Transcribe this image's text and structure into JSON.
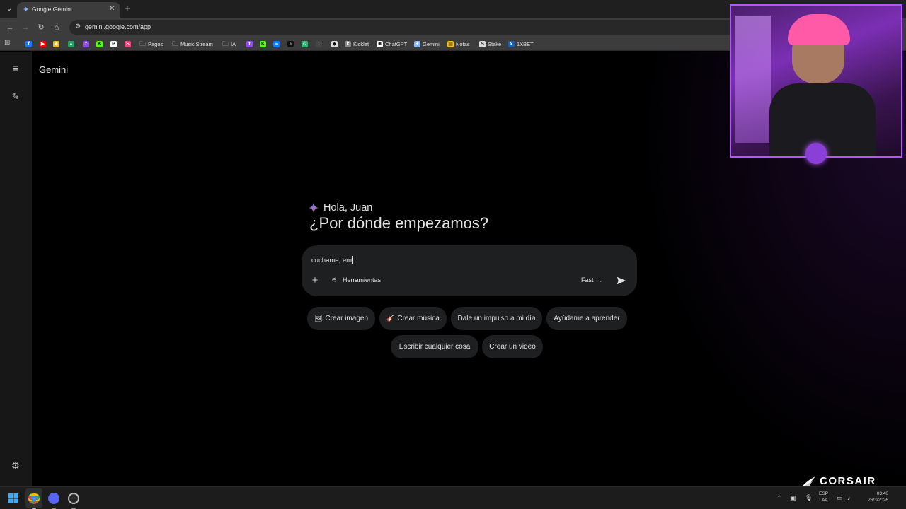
{
  "browser": {
    "tab_title": "Google Gemini",
    "tab_close": "✕",
    "new_tab": "+",
    "url": "gemini.google.com/app",
    "bookmarks": [
      {
        "label": "",
        "icon": "facebook-icon",
        "color": "#1877f2",
        "glyph": "f"
      },
      {
        "label": "",
        "icon": "youtube-icon",
        "color": "#ff0000",
        "glyph": "▶"
      },
      {
        "label": "",
        "icon": "binance-icon",
        "color": "#f0b90b",
        "glyph": "◆"
      },
      {
        "label": "",
        "icon": "google-drive-icon",
        "color": "#1fa463",
        "glyph": "▲"
      },
      {
        "label": "",
        "icon": "twitch-icon",
        "color": "#9146ff",
        "glyph": "t"
      },
      {
        "label": "",
        "icon": "kick-icon",
        "color": "#53fc18",
        "glyph": "K"
      },
      {
        "label": "",
        "icon": "patreon-icon",
        "color": "#ffffff",
        "glyph": "P"
      },
      {
        "label": "",
        "icon": "streamlabs-icon",
        "color": "#e8467c",
        "glyph": "S"
      },
      {
        "label": "Pagos",
        "icon": "folder-icon",
        "color": "",
        "glyph": ""
      },
      {
        "label": "Music Stream",
        "icon": "folder-icon",
        "color": "",
        "glyph": ""
      },
      {
        "label": "IA",
        "icon": "folder-icon",
        "color": "",
        "glyph": ""
      },
      {
        "label": "",
        "icon": "twitch-icon",
        "color": "#9146ff",
        "glyph": "t"
      },
      {
        "label": "",
        "icon": "kick-icon",
        "color": "#53fc18",
        "glyph": "K"
      },
      {
        "label": "",
        "icon": "meta-icon",
        "color": "#0081fb",
        "glyph": "∞"
      },
      {
        "label": "",
        "icon": "tiktok-icon",
        "color": "#111111",
        "glyph": "♪"
      },
      {
        "label": "",
        "icon": "refresh-app-icon",
        "color": "#2ab673",
        "glyph": "↻"
      },
      {
        "label": "",
        "icon": "misc-icon",
        "color": "#444444",
        "glyph": "!"
      },
      {
        "label": "",
        "icon": "diamond-icon",
        "color": "#dddddd",
        "glyph": "◆"
      },
      {
        "label": "Kicklet",
        "icon": "kicklet-icon",
        "color": "#888888",
        "glyph": "k"
      },
      {
        "label": "ChatGPT",
        "icon": "chatgpt-icon",
        "color": "#ffffff",
        "glyph": "✺"
      },
      {
        "label": "Gemini",
        "icon": "gemini-icon",
        "color": "#8ab4f8",
        "glyph": "✦"
      },
      {
        "label": "Notas",
        "icon": "notes-icon",
        "color": "#fbbc04",
        "glyph": "▤"
      },
      {
        "label": "Stake",
        "icon": "stake-icon",
        "color": "#dddddd",
        "glyph": "S"
      },
      {
        "label": "1XBET",
        "icon": "onexbet-icon",
        "color": "#1a5fb4",
        "glyph": "x"
      }
    ]
  },
  "app": {
    "brand": "Gemini",
    "greeting": "Hola, Juan",
    "headline": "¿Por dónde empezamos?",
    "prompt_text": "cuchame, em",
    "tools_label": "Herramientas",
    "mode_label": "Fast",
    "chips_row1": [
      {
        "label": "Crear imagen",
        "icon": "🖼"
      },
      {
        "label": "Crear música",
        "icon": "🎸"
      },
      {
        "label": "Dale un impulso a mi día",
        "icon": ""
      },
      {
        "label": "Ayúdame a aprender",
        "icon": ""
      }
    ],
    "chips_row2": [
      {
        "label": "Escribir cualquier cosa",
        "icon": ""
      },
      {
        "label": "Crear un video",
        "icon": ""
      }
    ]
  },
  "overlay": {
    "brand": "CORSAIR"
  },
  "taskbar": {
    "lang_1": "ESP",
    "lang_2": "LAA",
    "time": "03:40",
    "date": "26/3/2026"
  },
  "colors": {
    "accent": "#8ab4f8",
    "cam_border": "#b455ff",
    "composer_bg": "#1e1f20"
  }
}
